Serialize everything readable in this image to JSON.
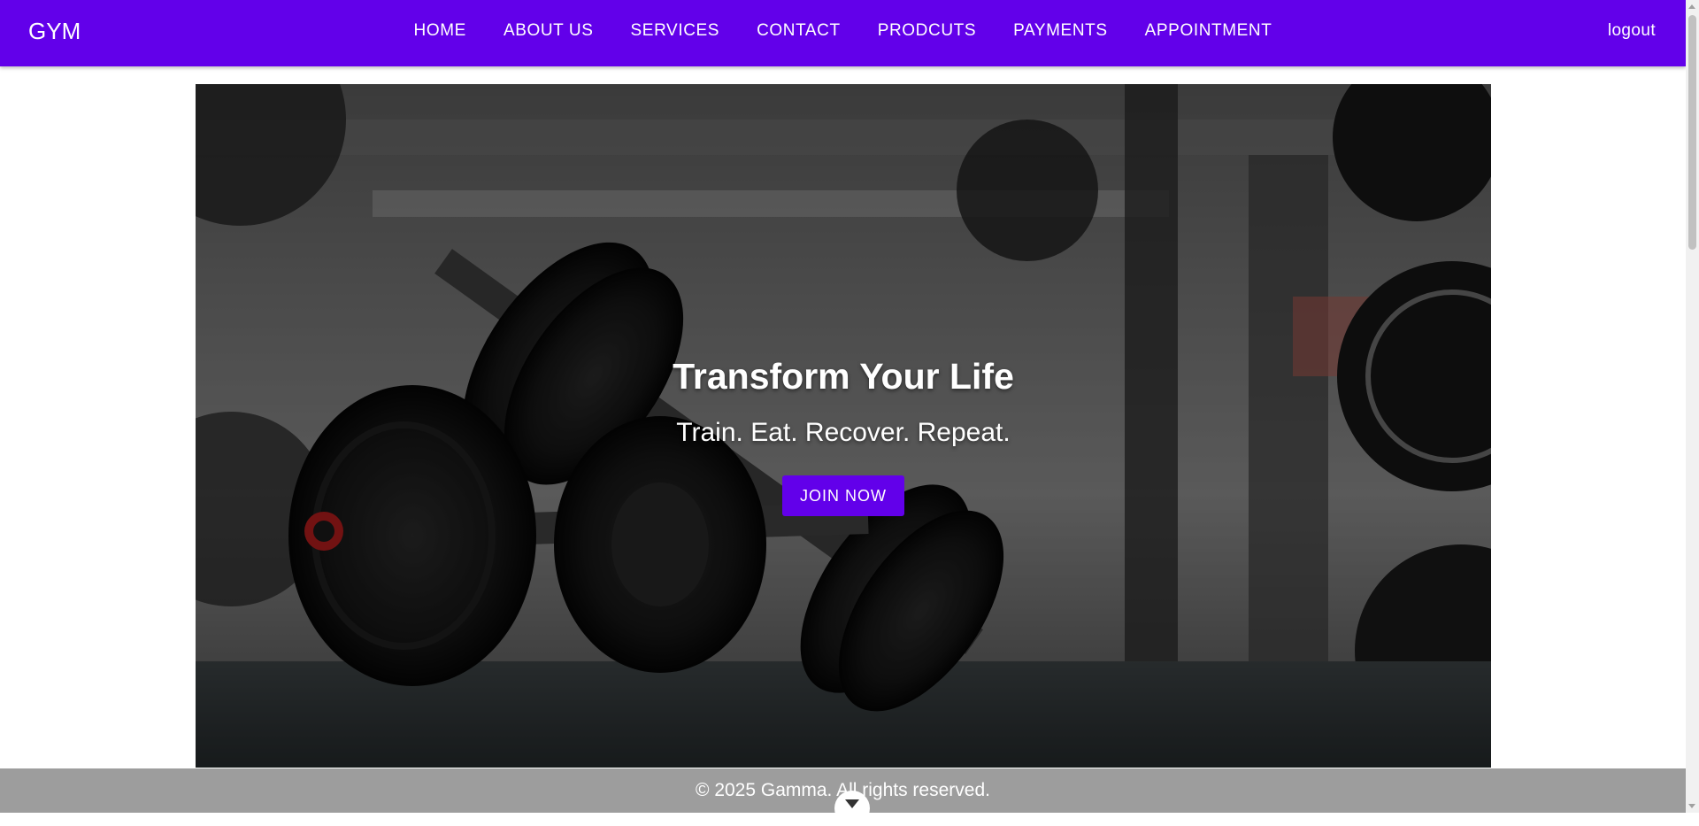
{
  "colors": {
    "brand_primary": "#6200ea",
    "footer_background": "#969696",
    "text_light": "#ffffff"
  },
  "navbar": {
    "brand": "GYM",
    "links": [
      {
        "label": "HOME"
      },
      {
        "label": "ABOUT US"
      },
      {
        "label": "SERVICES"
      },
      {
        "label": "CONTACT"
      },
      {
        "label": "PRODCUTS"
      },
      {
        "label": "PAYMENTS"
      },
      {
        "label": "APPOINTMENT"
      }
    ],
    "logout": "logout"
  },
  "hero": {
    "title": "Transform Your Life",
    "subtitle": "Train. Eat. Recover. Repeat.",
    "cta_label": "JOIN NOW",
    "background_image": "gym-dumbbells-photo"
  },
  "footer": {
    "text": "© 2025 Gamma. All rights reserved.",
    "scroll_icon": "chevron-down-icon"
  }
}
